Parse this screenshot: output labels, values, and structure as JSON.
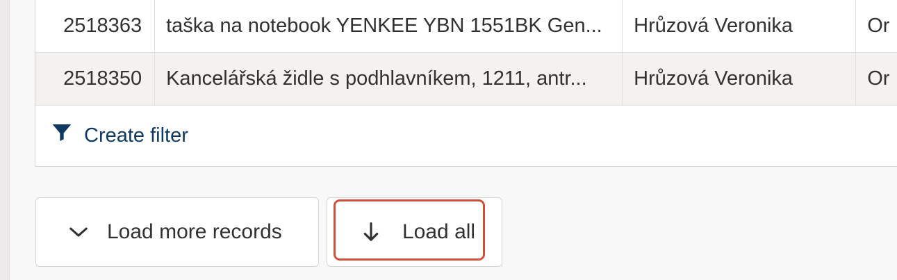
{
  "table": {
    "rows": [
      {
        "id": "2518363",
        "name": "taška na notebook YENKEE YBN 1551BK Gen...",
        "owner": "Hrůzová Veronika",
        "extra": "Or"
      },
      {
        "id": "2518350",
        "name": "Kancelářská židle s podhlavníkem, 1211, antr...",
        "owner": "Hrůzová Veronika",
        "extra": "Or"
      }
    ],
    "create_filter_label": "Create filter"
  },
  "actions": {
    "load_more_label": "Load more records",
    "load_all_label": "Load all"
  },
  "icons": {
    "filter": "filter-icon",
    "load_more": "chevron-down-icon",
    "load_all": "arrow-down-icon"
  },
  "colors": {
    "link": "#0f3a63",
    "highlight": "#d1503c",
    "alt_row": "#f3f2f1"
  }
}
